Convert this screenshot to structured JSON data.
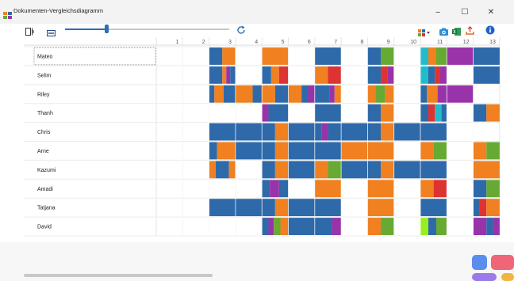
{
  "window": {
    "title": "Dokumenten-Vergleichsdiagramm",
    "minimize_label": "–",
    "maximize_label": "☐",
    "close_label": "✕"
  },
  "toolbar": {
    "zoom_level": 0.25,
    "icons": [
      "document-icon",
      "fit-width-icon",
      "refresh-icon",
      "palette-icon",
      "camera-icon",
      "excel-icon",
      "export-icon",
      "info-icon"
    ]
  },
  "chart_data": {
    "type": "heatmap",
    "columns": [
      "1",
      "2",
      "3",
      "4",
      "5",
      "6",
      "7",
      "8",
      "9",
      "10",
      "11",
      "12",
      "13"
    ],
    "rows": [
      {
        "name": "Mateo",
        "segments": [
          {
            "col": 3,
            "start": 0.0,
            "end": 0.5,
            "color": "#2e6aaa"
          },
          {
            "col": 3,
            "start": 0.5,
            "end": 1.0,
            "color": "#f08020"
          },
          {
            "col": 5,
            "start": 0.0,
            "end": 1.0,
            "color": "#f08020"
          },
          {
            "col": 7,
            "start": 0.0,
            "end": 1.0,
            "color": "#2e6aaa"
          },
          {
            "col": 9,
            "start": 0.0,
            "end": 0.5,
            "color": "#2e6aaa"
          },
          {
            "col": 9,
            "start": 0.5,
            "end": 1.0,
            "color": "#66aa33"
          },
          {
            "col": 11,
            "start": 0.0,
            "end": 0.3,
            "color": "#22bbcc"
          },
          {
            "col": 11,
            "start": 0.3,
            "end": 0.6,
            "color": "#f08020"
          },
          {
            "col": 11,
            "start": 0.6,
            "end": 1.0,
            "color": "#66aa33"
          },
          {
            "col": 12,
            "start": 0.0,
            "end": 1.0,
            "color": "#9933aa"
          },
          {
            "col": 13,
            "start": 0.0,
            "end": 1.0,
            "color": "#2e6aaa"
          }
        ]
      },
      {
        "name": "Selim",
        "segments": [
          {
            "col": 3,
            "start": 0.0,
            "end": 0.5,
            "color": "#2e6aaa"
          },
          {
            "col": 3,
            "start": 0.5,
            "end": 0.65,
            "color": "#f08020"
          },
          {
            "col": 3,
            "start": 0.65,
            "end": 0.8,
            "color": "#9933aa"
          },
          {
            "col": 3,
            "start": 0.8,
            "end": 1.0,
            "color": "#2e6aaa"
          },
          {
            "col": 5,
            "start": 0.0,
            "end": 0.35,
            "color": "#2e6aaa"
          },
          {
            "col": 5,
            "start": 0.35,
            "end": 0.65,
            "color": "#f08020"
          },
          {
            "col": 5,
            "start": 0.65,
            "end": 1.0,
            "color": "#dd3333"
          },
          {
            "col": 7,
            "start": 0.0,
            "end": 0.5,
            "color": "#f08020"
          },
          {
            "col": 7,
            "start": 0.5,
            "end": 1.0,
            "color": "#dd3333"
          },
          {
            "col": 9,
            "start": 0.0,
            "end": 0.5,
            "color": "#2e6aaa"
          },
          {
            "col": 9,
            "start": 0.5,
            "end": 0.75,
            "color": "#dd3333"
          },
          {
            "col": 9,
            "start": 0.75,
            "end": 1.0,
            "color": "#9933aa"
          },
          {
            "col": 11,
            "start": 0.0,
            "end": 0.3,
            "color": "#22bbcc"
          },
          {
            "col": 11,
            "start": 0.3,
            "end": 0.55,
            "color": "#2e6aaa"
          },
          {
            "col": 11,
            "start": 0.55,
            "end": 0.75,
            "color": "#dd3333"
          },
          {
            "col": 11,
            "start": 0.75,
            "end": 1.0,
            "color": "#9933aa"
          },
          {
            "col": 13,
            "start": 0.0,
            "end": 1.0,
            "color": "#2e6aaa"
          }
        ]
      },
      {
        "name": "Riley",
        "segments": [
          {
            "col": 3,
            "start": 0.0,
            "end": 0.2,
            "color": "#2e6aaa"
          },
          {
            "col": 3,
            "start": 0.2,
            "end": 0.55,
            "color": "#f08020"
          },
          {
            "col": 3,
            "start": 0.55,
            "end": 1.0,
            "color": "#2e6aaa"
          },
          {
            "col": 4,
            "start": 0.0,
            "end": 0.65,
            "color": "#f08020"
          },
          {
            "col": 4,
            "start": 0.65,
            "end": 1.0,
            "color": "#2e6aaa"
          },
          {
            "col": 5,
            "start": 0.0,
            "end": 0.5,
            "color": "#f08020"
          },
          {
            "col": 5,
            "start": 0.5,
            "end": 1.0,
            "color": "#2e6aaa"
          },
          {
            "col": 6,
            "start": 0.0,
            "end": 0.5,
            "color": "#f08020"
          },
          {
            "col": 6,
            "start": 0.5,
            "end": 0.75,
            "color": "#2e6aaa"
          },
          {
            "col": 6,
            "start": 0.75,
            "end": 1.0,
            "color": "#9933aa"
          },
          {
            "col": 7,
            "start": 0.0,
            "end": 0.55,
            "color": "#2e6aaa"
          },
          {
            "col": 7,
            "start": 0.55,
            "end": 0.75,
            "color": "#9933aa"
          },
          {
            "col": 7,
            "start": 0.75,
            "end": 1.0,
            "color": "#f08020"
          },
          {
            "col": 9,
            "start": 0.0,
            "end": 0.3,
            "color": "#f08020"
          },
          {
            "col": 9,
            "start": 0.3,
            "end": 0.65,
            "color": "#66aa33"
          },
          {
            "col": 9,
            "start": 0.65,
            "end": 1.0,
            "color": "#f08020"
          },
          {
            "col": 11,
            "start": 0.0,
            "end": 0.25,
            "color": "#2e6aaa"
          },
          {
            "col": 11,
            "start": 0.25,
            "end": 0.65,
            "color": "#f08020"
          },
          {
            "col": 11,
            "start": 0.65,
            "end": 1.0,
            "color": "#9933aa"
          },
          {
            "col": 12,
            "start": 0.0,
            "end": 1.0,
            "color": "#9933aa"
          }
        ]
      },
      {
        "name": "Thanh",
        "segments": [
          {
            "col": 5,
            "start": 0.0,
            "end": 0.25,
            "color": "#9933aa"
          },
          {
            "col": 5,
            "start": 0.25,
            "end": 1.0,
            "color": "#2e6aaa"
          },
          {
            "col": 7,
            "start": 0.0,
            "end": 1.0,
            "color": "#2e6aaa"
          },
          {
            "col": 9,
            "start": 0.0,
            "end": 0.5,
            "color": "#2e6aaa"
          },
          {
            "col": 9,
            "start": 0.5,
            "end": 1.0,
            "color": "#f08020"
          },
          {
            "col": 11,
            "start": 0.0,
            "end": 0.3,
            "color": "#2e6aaa"
          },
          {
            "col": 11,
            "start": 0.3,
            "end": 0.55,
            "color": "#dd3333"
          },
          {
            "col": 11,
            "start": 0.55,
            "end": 0.8,
            "color": "#22bbcc"
          },
          {
            "col": 11,
            "start": 0.8,
            "end": 1.0,
            "color": "#2e6aaa"
          },
          {
            "col": 13,
            "start": 0.0,
            "end": 0.5,
            "color": "#2e6aaa"
          },
          {
            "col": 13,
            "start": 0.5,
            "end": 1.0,
            "color": "#f08020"
          }
        ]
      },
      {
        "name": "Chris",
        "segments": [
          {
            "col": 3,
            "start": 0.0,
            "end": 1.0,
            "color": "#2e6aaa"
          },
          {
            "col": 4,
            "start": 0.0,
            "end": 1.0,
            "color": "#2e6aaa"
          },
          {
            "col": 5,
            "start": 0.0,
            "end": 0.5,
            "color": "#2e6aaa"
          },
          {
            "col": 5,
            "start": 0.5,
            "end": 1.0,
            "color": "#f08020"
          },
          {
            "col": 6,
            "start": 0.0,
            "end": 1.0,
            "color": "#2e6aaa"
          },
          {
            "col": 7,
            "start": 0.0,
            "end": 0.25,
            "color": "#2e6aaa"
          },
          {
            "col": 7,
            "start": 0.25,
            "end": 0.5,
            "color": "#9933aa"
          },
          {
            "col": 7,
            "start": 0.5,
            "end": 1.0,
            "color": "#2e6aaa"
          },
          {
            "col": 8,
            "start": 0.0,
            "end": 1.0,
            "color": "#2e6aaa"
          },
          {
            "col": 9,
            "start": 0.0,
            "end": 0.5,
            "color": "#2e6aaa"
          },
          {
            "col": 9,
            "start": 0.5,
            "end": 1.0,
            "color": "#f08020"
          },
          {
            "col": 10,
            "start": 0.0,
            "end": 1.0,
            "color": "#2e6aaa"
          },
          {
            "col": 11,
            "start": 0.0,
            "end": 1.0,
            "color": "#2e6aaa"
          }
        ]
      },
      {
        "name": "Arne",
        "segments": [
          {
            "col": 3,
            "start": 0.0,
            "end": 0.3,
            "color": "#2e6aaa"
          },
          {
            "col": 3,
            "start": 0.3,
            "end": 1.0,
            "color": "#f08020"
          },
          {
            "col": 4,
            "start": 0.0,
            "end": 1.0,
            "color": "#2e6aaa"
          },
          {
            "col": 5,
            "start": 0.0,
            "end": 0.5,
            "color": "#2e6aaa"
          },
          {
            "col": 5,
            "start": 0.5,
            "end": 1.0,
            "color": "#f08020"
          },
          {
            "col": 6,
            "start": 0.0,
            "end": 1.0,
            "color": "#2e6aaa"
          },
          {
            "col": 7,
            "start": 0.0,
            "end": 1.0,
            "color": "#2e6aaa"
          },
          {
            "col": 8,
            "start": 0.0,
            "end": 1.0,
            "color": "#f08020"
          },
          {
            "col": 9,
            "start": 0.0,
            "end": 1.0,
            "color": "#f08020"
          },
          {
            "col": 11,
            "start": 0.0,
            "end": 0.5,
            "color": "#f08020"
          },
          {
            "col": 11,
            "start": 0.5,
            "end": 1.0,
            "color": "#66aa33"
          },
          {
            "col": 13,
            "start": 0.0,
            "end": 0.5,
            "color": "#f08020"
          },
          {
            "col": 13,
            "start": 0.5,
            "end": 1.0,
            "color": "#66aa33"
          }
        ]
      },
      {
        "name": "Kazumi",
        "segments": [
          {
            "col": 3,
            "start": 0.0,
            "end": 0.25,
            "color": "#f08020"
          },
          {
            "col": 3,
            "start": 0.25,
            "end": 0.75,
            "color": "#2e6aaa"
          },
          {
            "col": 3,
            "start": 0.75,
            "end": 1.0,
            "color": "#f08020"
          },
          {
            "col": 5,
            "start": 0.0,
            "end": 0.5,
            "color": "#2e6aaa"
          },
          {
            "col": 5,
            "start": 0.5,
            "end": 1.0,
            "color": "#f08020"
          },
          {
            "col": 6,
            "start": 0.0,
            "end": 1.0,
            "color": "#2e6aaa"
          },
          {
            "col": 7,
            "start": 0.0,
            "end": 0.5,
            "color": "#f08020"
          },
          {
            "col": 7,
            "start": 0.5,
            "end": 1.0,
            "color": "#66aa33"
          },
          {
            "col": 8,
            "start": 0.0,
            "end": 1.0,
            "color": "#2e6aaa"
          },
          {
            "col": 9,
            "start": 0.0,
            "end": 0.5,
            "color": "#2e6aaa"
          },
          {
            "col": 9,
            "start": 0.5,
            "end": 1.0,
            "color": "#f08020"
          },
          {
            "col": 10,
            "start": 0.0,
            "end": 1.0,
            "color": "#2e6aaa"
          },
          {
            "col": 11,
            "start": 0.0,
            "end": 1.0,
            "color": "#2e6aaa"
          },
          {
            "col": 13,
            "start": 0.0,
            "end": 1.0,
            "color": "#f08020"
          }
        ]
      },
      {
        "name": "Amadi",
        "segments": [
          {
            "col": 5,
            "start": 0.0,
            "end": 0.3,
            "color": "#2e6aaa"
          },
          {
            "col": 5,
            "start": 0.3,
            "end": 0.65,
            "color": "#9933aa"
          },
          {
            "col": 5,
            "start": 0.65,
            "end": 1.0,
            "color": "#2e6aaa"
          },
          {
            "col": 7,
            "start": 0.0,
            "end": 1.0,
            "color": "#f08020"
          },
          {
            "col": 9,
            "start": 0.0,
            "end": 1.0,
            "color": "#f08020"
          },
          {
            "col": 11,
            "start": 0.0,
            "end": 0.5,
            "color": "#f08020"
          },
          {
            "col": 11,
            "start": 0.5,
            "end": 1.0,
            "color": "#dd3333"
          },
          {
            "col": 13,
            "start": 0.0,
            "end": 0.5,
            "color": "#2e6aaa"
          },
          {
            "col": 13,
            "start": 0.5,
            "end": 1.0,
            "color": "#66aa33"
          }
        ]
      },
      {
        "name": "Tatjana",
        "segments": [
          {
            "col": 3,
            "start": 0.0,
            "end": 1.0,
            "color": "#2e6aaa"
          },
          {
            "col": 4,
            "start": 0.0,
            "end": 1.0,
            "color": "#2e6aaa"
          },
          {
            "col": 5,
            "start": 0.0,
            "end": 0.5,
            "color": "#2e6aaa"
          },
          {
            "col": 5,
            "start": 0.5,
            "end": 1.0,
            "color": "#f08020"
          },
          {
            "col": 6,
            "start": 0.0,
            "end": 1.0,
            "color": "#2e6aaa"
          },
          {
            "col": 7,
            "start": 0.0,
            "end": 1.0,
            "color": "#2e6aaa"
          },
          {
            "col": 9,
            "start": 0.0,
            "end": 1.0,
            "color": "#f08020"
          },
          {
            "col": 11,
            "start": 0.0,
            "end": 1.0,
            "color": "#2e6aaa"
          },
          {
            "col": 13,
            "start": 0.0,
            "end": 0.25,
            "color": "#2e6aaa"
          },
          {
            "col": 13,
            "start": 0.25,
            "end": 0.5,
            "color": "#dd3333"
          },
          {
            "col": 13,
            "start": 0.5,
            "end": 1.0,
            "color": "#f08020"
          }
        ]
      },
      {
        "name": "David",
        "segments": [
          {
            "col": 5,
            "start": 0.0,
            "end": 0.25,
            "color": "#2e6aaa"
          },
          {
            "col": 5,
            "start": 0.25,
            "end": 0.45,
            "color": "#9933aa"
          },
          {
            "col": 5,
            "start": 0.45,
            "end": 0.7,
            "color": "#66aa33"
          },
          {
            "col": 5,
            "start": 0.7,
            "end": 1.0,
            "color": "#f08020"
          },
          {
            "col": 6,
            "start": 0.0,
            "end": 1.0,
            "color": "#2e6aaa"
          },
          {
            "col": 7,
            "start": 0.0,
            "end": 0.65,
            "color": "#2e6aaa"
          },
          {
            "col": 7,
            "start": 0.65,
            "end": 1.0,
            "color": "#9933aa"
          },
          {
            "col": 9,
            "start": 0.0,
            "end": 0.5,
            "color": "#f08020"
          },
          {
            "col": 9,
            "start": 0.5,
            "end": 1.0,
            "color": "#66aa33"
          },
          {
            "col": 11,
            "start": 0.0,
            "end": 0.3,
            "color": "#99ee22"
          },
          {
            "col": 11,
            "start": 0.3,
            "end": 0.6,
            "color": "#2e6aaa"
          },
          {
            "col": 11,
            "start": 0.6,
            "end": 1.0,
            "color": "#66aa33"
          },
          {
            "col": 13,
            "start": 0.0,
            "end": 0.5,
            "color": "#9933aa"
          },
          {
            "col": 13,
            "start": 0.5,
            "end": 0.75,
            "color": "#2e6aaa"
          },
          {
            "col": 13,
            "start": 0.75,
            "end": 1.0,
            "color": "#9933aa"
          }
        ]
      }
    ]
  },
  "colors": {
    "blue": "#2e6aaa",
    "orange": "#f08020",
    "green": "#66aa33",
    "purple": "#9933aa",
    "red": "#dd3333",
    "cyan": "#22bbcc",
    "lime": "#99ee22",
    "accent": "#2c6fb3"
  }
}
